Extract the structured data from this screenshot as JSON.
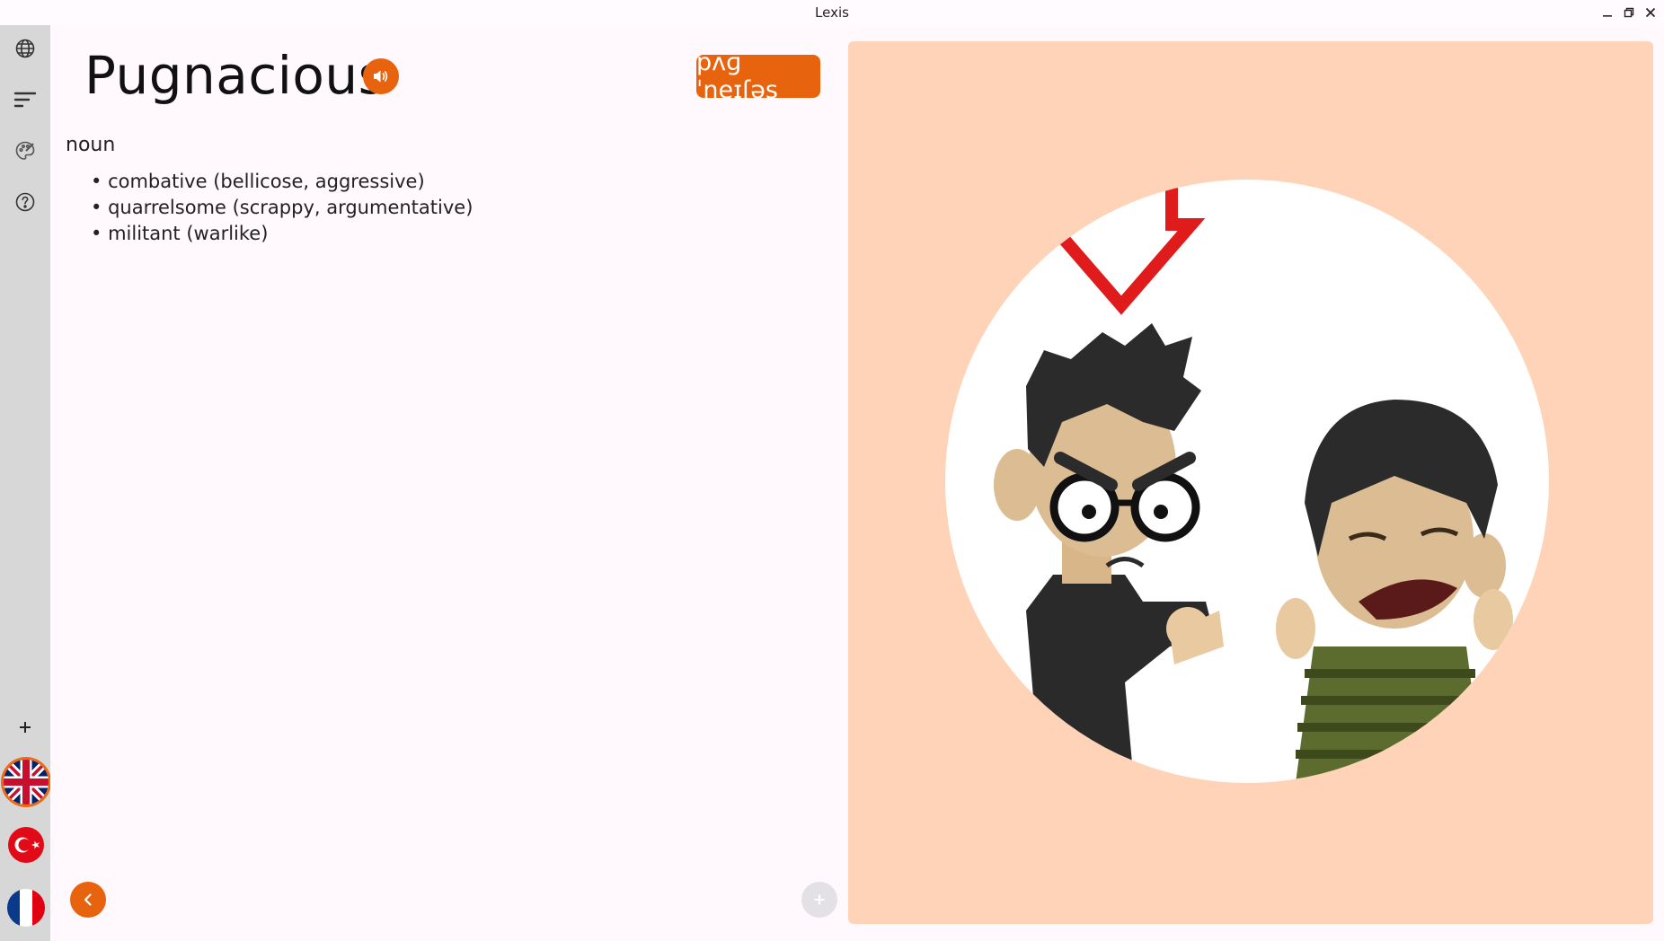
{
  "window": {
    "title": "Lexis",
    "controls": [
      "minimize-icon",
      "restore-icon",
      "close-icon"
    ]
  },
  "rail": {
    "top_icons": [
      "globe-icon",
      "sort-icon",
      "palette-icon",
      "help-icon"
    ],
    "add_icon": "plus-icon",
    "flags": [
      {
        "name": "uk-flag",
        "active": true
      },
      {
        "name": "turkey-flag",
        "active": false
      },
      {
        "name": "france-flag",
        "active": false
      }
    ]
  },
  "entry": {
    "word": "Pugnacious",
    "ipa": "pʌɡˈneɪʃəs",
    "part_of_speech": "noun",
    "definitions": [
      "combative (bellicose, aggressive)",
      "quarrelsome (scrappy, argumentative)",
      "militant (warlike)"
    ]
  },
  "colors": {
    "accent": "#e8630d",
    "panel": "#ffd3b8",
    "rail": "#d7d7d7"
  }
}
